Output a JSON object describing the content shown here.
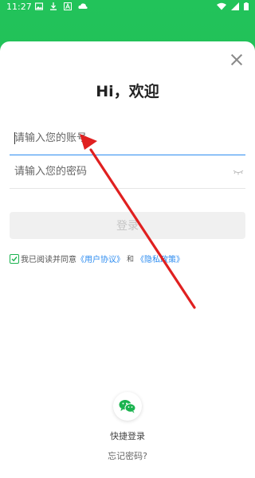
{
  "status_bar": {
    "time": "11:27",
    "left_icons": [
      "image-icon",
      "download-icon",
      "a-icon",
      "cloud-icon"
    ],
    "right_icons": [
      "wifi-icon",
      "signal-icon",
      "battery-icon"
    ]
  },
  "login": {
    "title": "Hi，欢迎",
    "account_placeholder": "请输入您的账号",
    "password_placeholder": "请输入您的密码",
    "login_button": "登录"
  },
  "agreement": {
    "prefix": "我已阅读并同意",
    "user_agreement": "《用户协议》",
    "and": "和",
    "privacy_policy": "《隐私政策》",
    "checked": true
  },
  "quick_login": {
    "label": "快捷登录",
    "icon": "wechat-icon"
  },
  "forgot_password": "忘记密码?",
  "colors": {
    "brand_green": "#1bb34f",
    "link_blue": "#2d8cf0",
    "annotation_red": "#e02020"
  },
  "annotation": {
    "type": "arrow",
    "color": "#e02020"
  }
}
